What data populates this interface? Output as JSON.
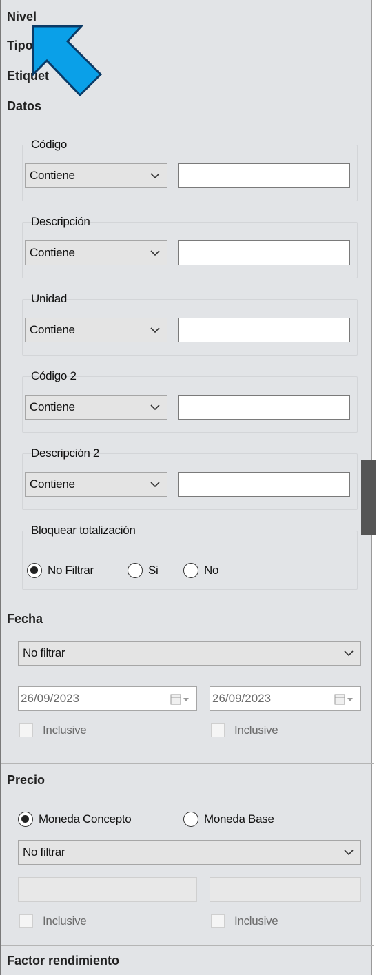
{
  "sections": {
    "nivel": "Nivel",
    "tipo": "Tipo",
    "etiquetas": "Etiquet",
    "datos": "Datos",
    "fecha": "Fecha",
    "precio": "Precio",
    "factor": "Factor rendimiento"
  },
  "datos": {
    "fields": [
      {
        "label": "Código",
        "operator": "Contiene",
        "value": ""
      },
      {
        "label": "Descripción",
        "operator": "Contiene",
        "value": ""
      },
      {
        "label": "Unidad",
        "operator": "Contiene",
        "value": ""
      },
      {
        "label": "Código 2",
        "operator": "Contiene",
        "value": ""
      },
      {
        "label": "Descripción 2",
        "operator": "Contiene",
        "value": ""
      }
    ],
    "bloquear": {
      "label": "Bloquear totalización",
      "options": [
        "No Filtrar",
        "Si",
        "No"
      ],
      "selected": "No Filtrar"
    }
  },
  "fecha": {
    "mode": "No filtrar",
    "from": "26/09/2023",
    "to": "26/09/2023",
    "inclusive_label": "Inclusive"
  },
  "precio": {
    "currency_options": [
      "Moneda Concepto",
      "Moneda Base"
    ],
    "selected_currency": "Moneda Concepto",
    "mode": "No filtrar",
    "from": "",
    "to": "",
    "inclusive_label": "Inclusive"
  },
  "colors": {
    "panel_bg": "#e2e4e7",
    "cursor_fill": "#0aa0e8"
  }
}
